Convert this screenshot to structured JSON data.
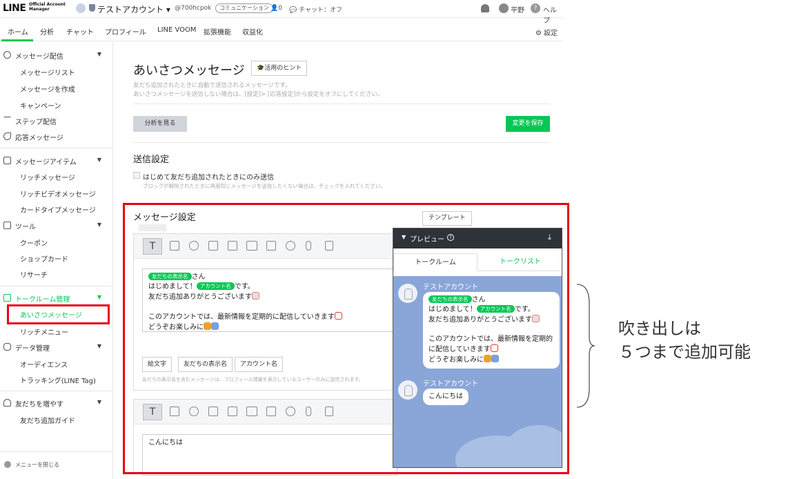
{
  "topbar": {
    "logo": "LINE",
    "logo_sub_1": "Official Account",
    "logo_sub_2": "Manager",
    "account_name": "テストアカウント ▾",
    "account_id": "@700hcpok",
    "plan_badge": "コミュニケーション",
    "friend_count": "0",
    "chat_status": "チャット：オフ",
    "user_name": "平野",
    "help_label": "ヘルプ",
    "help_glyph": "?"
  },
  "nav": {
    "tabs": [
      "ホーム",
      "分析",
      "チャット",
      "プロフィール",
      "LINE VOOM",
      "拡張機能",
      "収益化"
    ],
    "settings": "設定"
  },
  "sidebar": {
    "sections": [
      {
        "label": "メッセージ配信",
        "items": [
          "メッセージリスト",
          "メッセージを作成",
          "キャンペーン"
        ]
      },
      {
        "label": "ステップ配信"
      },
      {
        "label": "応答メッセージ"
      },
      {
        "label": "メッセージアイテム",
        "items": [
          "リッチメッセージ",
          "リッチビデオメッセージ",
          "カードタイプメッセージ"
        ]
      },
      {
        "label": "ツール",
        "items": [
          "クーポン",
          "ショップカード",
          "リサーチ"
        ]
      },
      {
        "label": "トークルーム管理",
        "items": [
          "あいさつメッセージ",
          "リッチメニュー"
        ]
      },
      {
        "label": "データ管理",
        "items": [
          "オーディエンス",
          "トラッキング(LINE Tag)"
        ]
      },
      {
        "label": "友だちを増やす",
        "items": [
          "友だち追加ガイド"
        ]
      }
    ],
    "collapse_label": "メニューを閉じる"
  },
  "main": {
    "title": "あいさつメッセージ",
    "hint_button": "活用のヒント",
    "desc_1": "友だち追加されたときに自動で送信されるメッセージです。",
    "desc_2": "あいさつメッセージを送信しない場合は、[設定]> [応答設定]から設定をオフにしてください。",
    "analyze_button": "分析を見る",
    "save_button": "変更を保存",
    "send_settings_title": "送信設定",
    "checkbox_label": "はじめて友だち追加されたときにのみ送信",
    "checkbox_note": "ブロックが解除されたときに再度同じメッセージを送信したくない場合は、チェックを入れてください。",
    "message_settings_title": "メッセージ設定",
    "template_button": "テンプレート",
    "message1": {
      "tag_friend": "友だちの表示名",
      "after_friend": "さん",
      "line2_pre": "はじめまして！",
      "tag_account": "アカウント名",
      "line2_post": "です。",
      "line3": "友だち追加ありがとうございます",
      "line5": "このアカウントでは、最新情報を定期的に配信していきます",
      "line6": "どうぞお楽しみに"
    },
    "insert_buttons": [
      "絵文字",
      "友だちの表示名",
      "アカウント名"
    ],
    "insert_note": "友だちの表示名を含むメッセージは、プロフィール情報を表示しているユーザーのみに送信されます。",
    "message2": "こんにちは"
  },
  "preview": {
    "title": "プレビュー",
    "help_glyph": "?",
    "download_glyph": "⤓",
    "tabs": [
      "トークルーム",
      "トークリスト"
    ],
    "sender": "テストアカウント",
    "bubble1": {
      "tag_friend": "友だちの表示名",
      "after_friend": "さん",
      "line2_pre": "はじめまして！",
      "tag_account": "アカウント名",
      "line2_post": "です。",
      "line3": "友だち追加ありがとうございます",
      "line5": "このアカウントでは、最新情報を定期的",
      "line6": "に配信していきます",
      "line7": "どうぞお楽しみに"
    },
    "bubble2": "こんにちは"
  },
  "annotation": {
    "line1": "吹き出しは",
    "line2": "５つまで追加可能"
  },
  "colors": {
    "brand_green": "#06c755",
    "highlight_red": "#e60012",
    "preview_bg": "#8aa6d8"
  }
}
